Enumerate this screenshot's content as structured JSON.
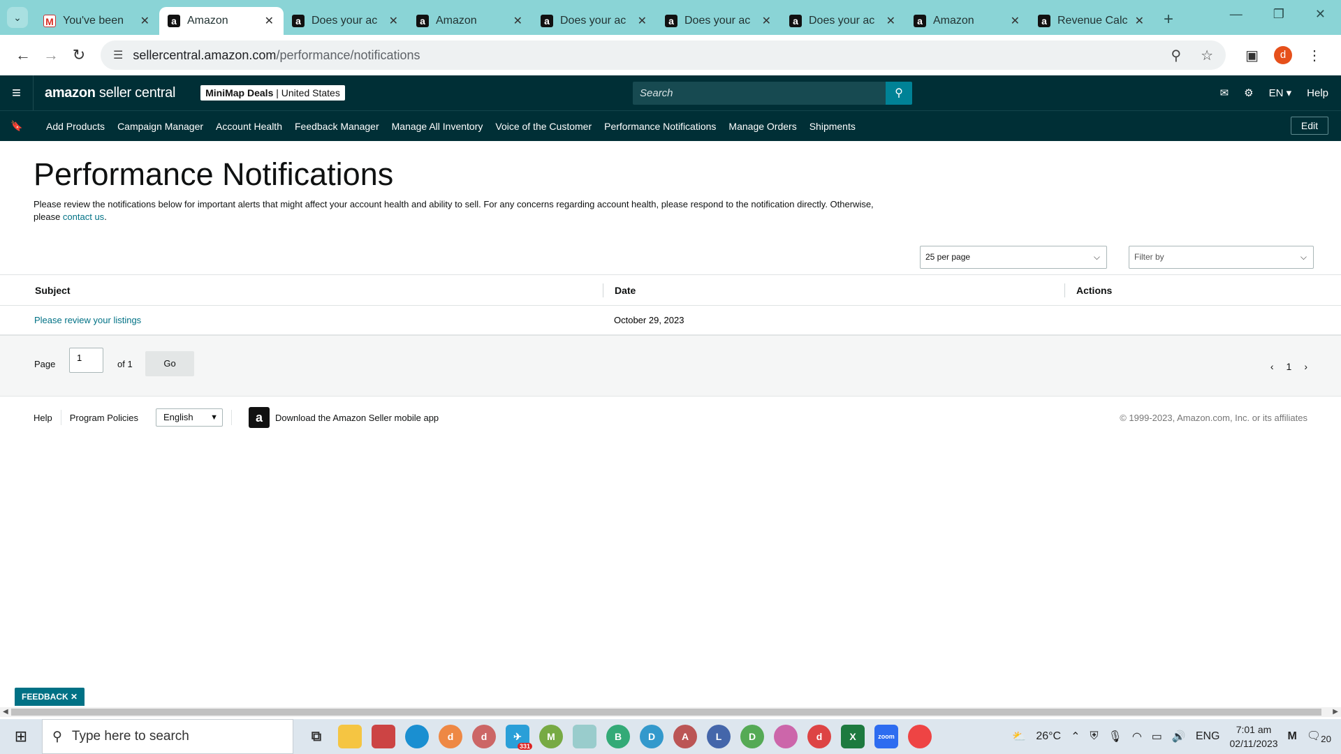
{
  "browser": {
    "tabs": [
      {
        "title": "You've been",
        "icon": "gmail-icon"
      },
      {
        "title": "Amazon",
        "icon": "amazon-icon",
        "active": true
      },
      {
        "title": "Does your ac",
        "icon": "amazon-icon"
      },
      {
        "title": "Amazon",
        "icon": "amazon-icon"
      },
      {
        "title": "Does your ac",
        "icon": "amazon-icon"
      },
      {
        "title": "Does your ac",
        "icon": "amazon-icon"
      },
      {
        "title": "Does your ac",
        "icon": "amazon-icon"
      },
      {
        "title": "Amazon",
        "icon": "amazon-icon"
      },
      {
        "title": "Revenue Calc",
        "icon": "amazon-icon"
      }
    ],
    "url_host": "sellercentral.amazon.com",
    "url_path": "/performance/notifications",
    "profile_initial": "d"
  },
  "header": {
    "logo_bold": "amazon",
    "logo_light": " seller central",
    "store_name": "MiniMap Deals",
    "store_region": "| United States",
    "search_placeholder": "Search",
    "language": "EN",
    "help": "Help"
  },
  "nav": {
    "items": [
      "Add Products",
      "Campaign Manager",
      "Account Health",
      "Feedback Manager",
      "Manage All Inventory",
      "Voice of the Customer",
      "Performance Notifications",
      "Manage Orders",
      "Shipments"
    ],
    "edit_label": "Edit"
  },
  "main": {
    "title": "Performance Notifications",
    "description": "Please review the notifications below for important alerts that might affect your account health and ability to sell. For any concerns regarding account health, please respond to the notification directly. Otherwise, please ",
    "contact_link": "contact us",
    "description_end": ".",
    "per_page": "25 per page",
    "filter_placeholder": "Filter by"
  },
  "table": {
    "columns": [
      "Subject",
      "Date",
      "Actions"
    ],
    "rows": [
      {
        "subject": "Please review your listings",
        "date": "October 29, 2023",
        "actions": ""
      }
    ]
  },
  "pager": {
    "page_label": "Page",
    "page_value": "1",
    "of_label": "of 1",
    "go_label": "Go",
    "current": "1"
  },
  "footer": {
    "help": "Help",
    "policies": "Program Policies",
    "language": "English",
    "app_text": "Download the Amazon Seller mobile app",
    "copyright": "© 1999-2023, Amazon.com, Inc. or its affiliates"
  },
  "feedback": "FEEDBACK",
  "taskbar": {
    "search_placeholder": "Type here to search",
    "weather": "26°C",
    "lang": "ENG",
    "time": "7:01 am",
    "date": "02/11/2023",
    "notif_count": "20",
    "telegram_badge": "331"
  },
  "colors": {
    "header_bg": "#002f36",
    "link": "#007185",
    "search_btn": "#008296",
    "tab_bar": "#8ad4d6"
  }
}
